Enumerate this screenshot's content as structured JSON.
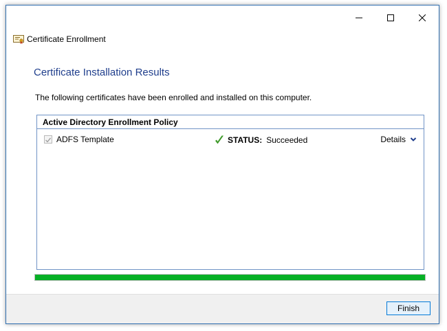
{
  "window": {
    "app_title": "Certificate Enrollment",
    "controls": {
      "minimize": "minimize-icon",
      "maximize": "maximize-icon",
      "close": "close-icon"
    }
  },
  "main": {
    "heading": "Certificate Installation Results",
    "description": "The following certificates have been enrolled and installed on this computer."
  },
  "policy": {
    "header": "Active Directory Enrollment Policy",
    "items": [
      {
        "name": "ADFS Template",
        "checked": true,
        "status_label": "STATUS:",
        "status_value": "Succeeded",
        "details_label": "Details"
      }
    ]
  },
  "progress": {
    "fraction": 1.0
  },
  "footer": {
    "finish_label": "Finish"
  },
  "colors": {
    "heading": "#1f3e8c",
    "border": "#6f93c6",
    "progress": "#06b025",
    "success_check": "#3f9a2a",
    "button_accent": "#0078d7"
  }
}
